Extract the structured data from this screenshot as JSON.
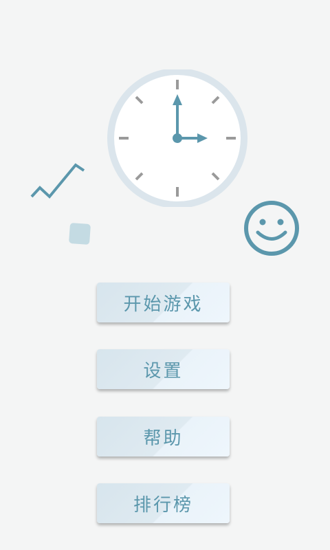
{
  "menu": {
    "start_label": "开始游戏",
    "settings_label": "设置",
    "help_label": "帮助",
    "leaderboard_label": "排行榜"
  },
  "decorations": {
    "clock": {
      "hour": 3,
      "minute": 0
    },
    "icons": [
      "clock-icon",
      "zigzag-line-icon",
      "square-icon",
      "smiley-face-icon"
    ]
  },
  "colors": {
    "background": "#f4f5f5",
    "accent": "#5b97ac",
    "button_light": "#eef6fc",
    "button_dark": "#d7e5ed",
    "clock_rim": "#dbe5ec",
    "square": "#c4dbe3"
  }
}
